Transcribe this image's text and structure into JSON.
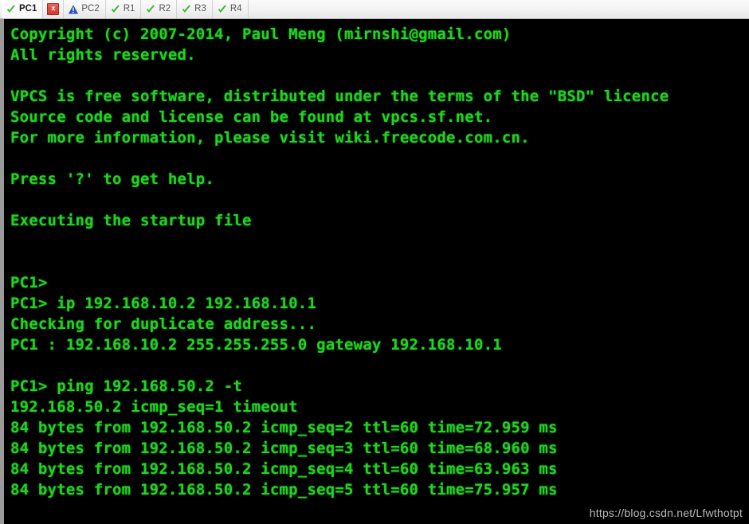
{
  "tabbar": {
    "tabs": [
      {
        "label": "PC1",
        "icon": "check-icon",
        "status": "ok",
        "active": true
      },
      {
        "label": "PC2",
        "icon": "warning-triangle-icon",
        "status": "warning",
        "active": false
      },
      {
        "label": "R1",
        "icon": "check-icon",
        "status": "ok",
        "active": false
      },
      {
        "label": "R2",
        "icon": "check-icon",
        "status": "ok",
        "active": false
      },
      {
        "label": "R3",
        "icon": "check-icon",
        "status": "ok",
        "active": false
      },
      {
        "label": "R4",
        "icon": "check-icon",
        "status": "ok",
        "active": false
      }
    ],
    "close_button_label": "x",
    "colors": {
      "check_green": "#3cb835",
      "warning_blue": "#2a52b5",
      "close_red": "#cf3a2e",
      "tab_text": "#555555",
      "active_tab_text": "#1a1a1a",
      "bar_background": "#f2f2f2"
    }
  },
  "terminal": {
    "colors": {
      "background": "#000000",
      "foreground": "#22d422"
    },
    "lines": [
      "Copyright (c) 2007-2014, Paul Meng (mirnshi@gmail.com)",
      "All rights reserved.",
      "",
      "VPCS is free software, distributed under the terms of the \"BSD\" licence",
      "Source code and license can be found at vpcs.sf.net.",
      "For more information, please visit wiki.freecode.com.cn.",
      "",
      "Press '?' to get help.",
      "",
      "Executing the startup file",
      "",
      "",
      "PC1>",
      "PC1> ip 192.168.10.2 192.168.10.1",
      "Checking for duplicate address...",
      "PC1 : 192.168.10.2 255.255.255.0 gateway 192.168.10.1",
      "",
      "PC1> ping 192.168.50.2 -t",
      "192.168.50.2 icmp_seq=1 timeout",
      "84 bytes from 192.168.50.2 icmp_seq=2 ttl=60 time=72.959 ms",
      "84 bytes from 192.168.50.2 icmp_seq=3 ttl=60 time=68.960 ms",
      "84 bytes from 192.168.50.2 icmp_seq=4 ttl=60 time=63.963 ms",
      "84 bytes from 192.168.50.2 icmp_seq=5 ttl=60 time=75.957 ms"
    ]
  },
  "watermark": {
    "text": "https://blog.csdn.net/Lfwthotpt"
  }
}
